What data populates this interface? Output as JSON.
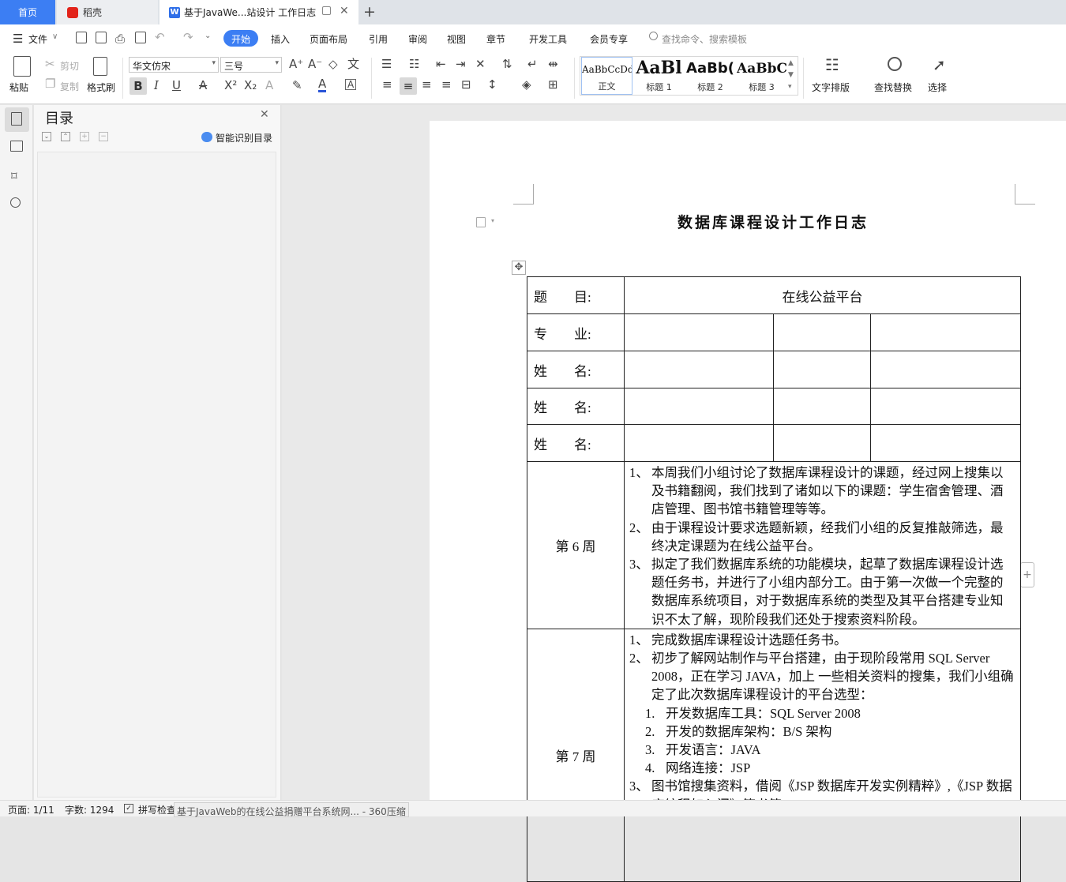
{
  "tabs": {
    "home": "首页",
    "daoke": "稻壳",
    "doc": "基于JavaWe...站设计 工作日志"
  },
  "menu": {
    "file": "文件",
    "items": [
      "开始",
      "插入",
      "页面布局",
      "引用",
      "审阅",
      "视图",
      "章节",
      "开发工具",
      "会员专享"
    ],
    "search": "查找命令、搜索模板"
  },
  "ribbon": {
    "paste": "粘贴",
    "cut": "剪切",
    "copy": "复制",
    "format_painter": "格式刷",
    "font_name": "华文仿宋",
    "font_size": "三号",
    "styles": [
      {
        "sample": "AaBbCcDd",
        "label": "正文"
      },
      {
        "sample": "AaBl",
        "label": "标题 1"
      },
      {
        "sample": "AaBb(",
        "label": "标题 2"
      },
      {
        "sample": "AaBbC",
        "label": "标题 3"
      }
    ],
    "text_layout": "文字排版",
    "find_replace": "查找替换",
    "select": "选择"
  },
  "outline": {
    "title": "目录",
    "smart": "智能识别目录"
  },
  "document": {
    "title": "数据库课程设计工作日志",
    "rows": [
      {
        "label": "题　　目:",
        "value": "在线公益平台"
      },
      {
        "label": "专　　业:"
      },
      {
        "label": "姓　　名:"
      },
      {
        "label": "姓　　名:"
      },
      {
        "label": "姓　　名:"
      }
    ],
    "week6": {
      "label": "第 6 周",
      "items": [
        {
          "n": "1、",
          "t": "本周我们小组讨论了数据库课程设计的课题，经过网上搜集以及书籍翻阅，我们找到了诸如以下的课题：学生宿舍管理、酒店管理、图书馆书籍管理等等。"
        },
        {
          "n": "2、",
          "t": "由于课程设计要求选题新颖，经我们小组的反复推敲筛选，最终决定课题为在线公益平台。"
        },
        {
          "n": "3、",
          "t": "拟定了我们数据库系统的功能模块，起草了数据库课程设计选题任务书，并进行了小组内部分工。由于第一次做一个完整的数据库系统项目，对于数据库系统的类型及其平台搭建专业知识不太了解，现阶段我们还处于搜索资料阶段。"
        }
      ]
    },
    "week7": {
      "label": "第 7 周",
      "items": [
        {
          "n": "1、",
          "t": "完成数据库课程设计选题任务书。"
        },
        {
          "n": "2、",
          "t": "初步了解网站制作与平台搭建，由于现阶段常用 SQL Server 2008，正在学习 JAVA，加上 一些相关资料的搜集，我们小组确定了此次数据库课程设计的平台选型："
        }
      ],
      "sub": [
        {
          "n": "1.",
          "t": "开发数据库工具：SQL Server 2008"
        },
        {
          "n": "2.",
          "t": "开发的数据库架构：B/S 架构"
        },
        {
          "n": "3.",
          "t": "开发语言：JAVA"
        },
        {
          "n": "4.",
          "t": "网络连接：JSP"
        }
      ],
      "last": {
        "n": "3、",
        "t": "图书馆搜集资料，借阅《JSP 数据库开发实例精粹》,《JSP 数据库编程如入门》等书籍。"
      }
    }
  },
  "status": {
    "page": "页面: 1/11",
    "words": "字数: 1294",
    "spell": "拼写检查",
    "task": "基于JavaWeb的在线公益捐赠平台系统网... - 360压缩"
  },
  "colors": {
    "accent": "#3c7ef3"
  }
}
